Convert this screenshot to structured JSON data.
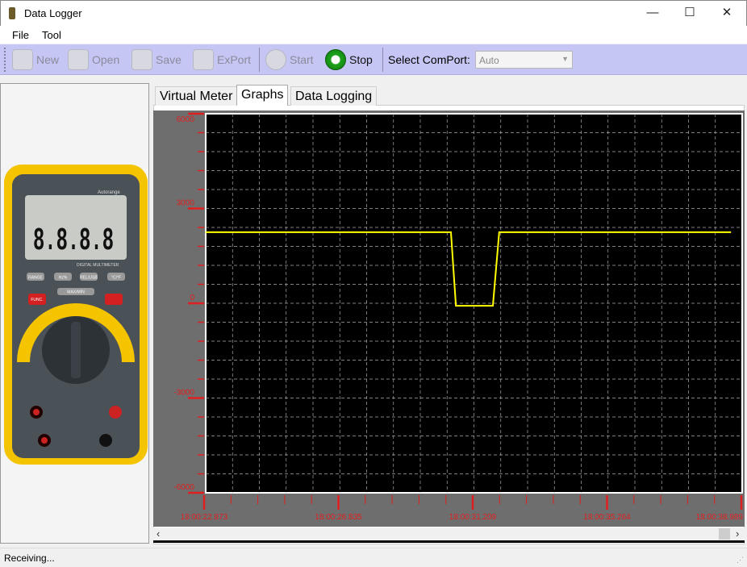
{
  "window": {
    "title": "Data Logger",
    "minimize": "—",
    "maximize": "☐",
    "close": "✕"
  },
  "menu": [
    "File",
    "Tool"
  ],
  "toolbar": {
    "buttons": [
      {
        "label": "New",
        "icon": "new-document-icon",
        "enabled": false
      },
      {
        "label": "Open",
        "icon": "open-folder-icon",
        "enabled": false
      },
      {
        "label": "Save",
        "icon": "floppy-disk-icon",
        "enabled": false
      },
      {
        "label": "ExPort",
        "icon": "xls-export-icon",
        "enabled": false
      },
      {
        "label": "Start",
        "icon": "play-icon",
        "enabled": false
      },
      {
        "label": "Stop",
        "icon": "stop-icon",
        "enabled": true
      }
    ],
    "comport_label": "Select ComPort:",
    "comport_value": "Auto"
  },
  "meter_image": {
    "brand_text": "Autorange",
    "model_text": "DIGITAL MULTIMETER",
    "display": "8.8.8.8",
    "buttons": [
      "RANGE",
      "Hz%",
      "REL/USB",
      "°C/°F",
      "MAX/MIN",
      "FUNC."
    ]
  },
  "tabs": [
    {
      "label": "Virtual Meter",
      "selected": false
    },
    {
      "label": "Graphs",
      "selected": true
    },
    {
      "label": "Data Logging",
      "selected": false
    }
  ],
  "chart_data": {
    "type": "line",
    "ylim": [
      -6000,
      6000
    ],
    "yticks": [
      6000,
      3000,
      0,
      -3000,
      -6000
    ],
    "ytick_labels": [
      "6000",
      "3000",
      "0",
      "-3000",
      "-6000"
    ],
    "xlim": [
      "18:00:22.873",
      "18:00:38.989"
    ],
    "xtick_labels": [
      "18:00:22.873",
      "18:00:26.835",
      "18:00:31.209",
      "18:00:35.264",
      "18:00:38.989"
    ],
    "grid": true,
    "colors": {
      "line": "#ffff00",
      "background": "#000000",
      "axis_text": "#e02020",
      "panel": "#6e6e6e"
    },
    "series": [
      {
        "x": [
          "18:00:22.873",
          "18:00:30.240",
          "18:00:30.390",
          "18:00:31.500",
          "18:00:31.690",
          "18:00:38.650"
        ],
        "y": [
          2250,
          2250,
          -80,
          -80,
          2250,
          2250
        ]
      }
    ]
  },
  "scrollbar": {
    "left": "‹",
    "right": "›"
  },
  "status": {
    "text": "Receiving..."
  }
}
